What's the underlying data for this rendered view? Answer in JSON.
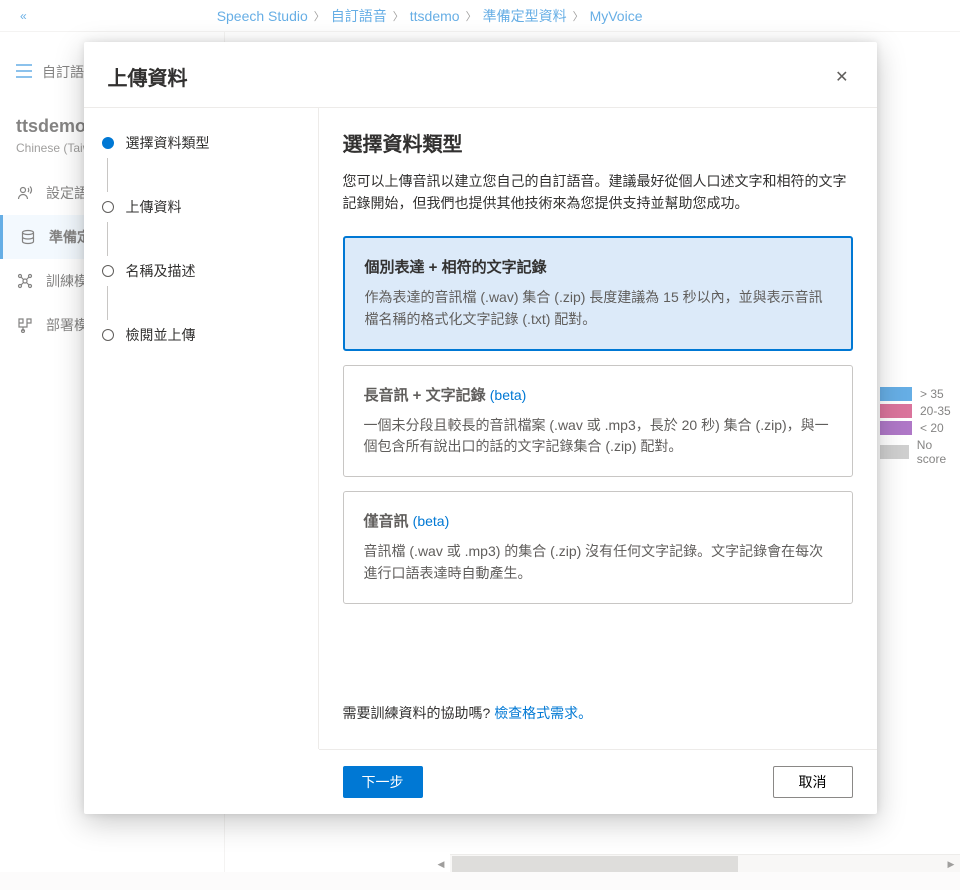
{
  "breadcrumb": {
    "items": [
      "Speech Studio",
      "自訂語音",
      "ttsdemo",
      "準備定型資料",
      "MyVoice"
    ]
  },
  "sidebar": {
    "custom_voice_label": "自訂語音",
    "project_title": "ttsdemo",
    "project_sub": "Chinese (Taiwan)",
    "items": [
      {
        "label": "設定語音人才"
      },
      {
        "label": "準備定型資料"
      },
      {
        "label": "訓練模型"
      },
      {
        "label": "部署模型"
      }
    ]
  },
  "legend": [
    {
      "color": "#0078d4",
      "label": "> 35"
    },
    {
      "color": "#c2185b",
      "label": "20-35"
    },
    {
      "color": "#7b1fa2",
      "label": "< 20"
    },
    {
      "color": "#b0b0b0",
      "label": "No score"
    }
  ],
  "modal": {
    "title": "上傳資料",
    "steps": [
      {
        "label": "選擇資料類型",
        "active": true
      },
      {
        "label": "上傳資料",
        "active": false
      },
      {
        "label": "名稱及描述",
        "active": false
      },
      {
        "label": "檢閱並上傳",
        "active": false
      }
    ],
    "main_title": "選擇資料類型",
    "main_desc": "您可以上傳音訊以建立您自己的自訂語音。建議最好從個人口述文字和相符的文字記錄開始，但我們也提供其他技術來為您提供支持並幫助您成功。",
    "cards": [
      {
        "title": "個別表達 + 相符的文字記錄",
        "beta": "",
        "desc": "作為表達的音訊檔 (.wav) 集合 (.zip) 長度建議為 15 秒以內，並與表示音訊檔名稱的格式化文字記錄 (.txt) 配對。",
        "selected": true
      },
      {
        "title": "長音訊 + 文字記錄 ",
        "beta": "(beta)",
        "desc": "一個未分段且較長的音訊檔案 (.wav 或 .mp3，長於 20 秒) 集合 (.zip)，與一個包含所有說出口的話的文字記錄集合 (.zip) 配對。",
        "selected": false
      },
      {
        "title": "僅音訊 ",
        "beta": "(beta)",
        "desc": "音訊檔 (.wav 或 .mp3) 的集合 (.zip) 沒有任何文字記錄。文字記錄會在每次進行口語表達時自動產生。",
        "selected": false
      }
    ],
    "help_text": "需要訓練資料的協助嗎? ",
    "help_link": "檢查格式需求。",
    "next_button": "下一步",
    "cancel_button": "取消"
  }
}
